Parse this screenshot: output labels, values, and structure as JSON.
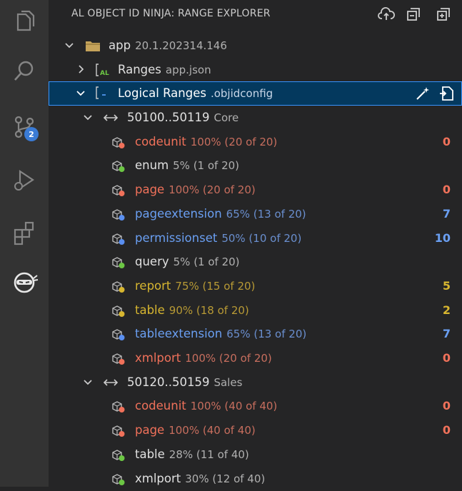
{
  "panel": {
    "title": "AL OBJECT ID NINJA: RANGE EXPLORER"
  },
  "activity": {
    "source_control_badge": "2"
  },
  "tree": {
    "app": {
      "label": "app",
      "desc": "20.1.202314.146"
    },
    "ranges": {
      "label": "Ranges",
      "desc": "app.json"
    },
    "logical": {
      "label": "Logical Ranges",
      "desc": ".objidconfig"
    },
    "groups": [
      {
        "range": "50100..50119",
        "name": "Core",
        "items": [
          {
            "name": "codeunit",
            "usage": "100% (20 of 20)",
            "count": "0",
            "status": "red"
          },
          {
            "name": "enum",
            "usage": "5% (1 of 20)",
            "count": "",
            "status": "green"
          },
          {
            "name": "page",
            "usage": "100% (20 of 20)",
            "count": "0",
            "status": "red"
          },
          {
            "name": "pageextension",
            "usage": "65% (13 of 20)",
            "count": "7",
            "status": "blue"
          },
          {
            "name": "permissionset",
            "usage": "50% (10 of 20)",
            "count": "10",
            "status": "blue"
          },
          {
            "name": "query",
            "usage": "5% (1 of 20)",
            "count": "",
            "status": "green"
          },
          {
            "name": "report",
            "usage": "75% (15 of 20)",
            "count": "5",
            "status": "yellow"
          },
          {
            "name": "table",
            "usage": "90% (18 of 20)",
            "count": "2",
            "status": "yellow"
          },
          {
            "name": "tableextension",
            "usage": "65% (13 of 20)",
            "count": "7",
            "status": "blue"
          },
          {
            "name": "xmlport",
            "usage": "100% (20 of 20)",
            "count": "0",
            "status": "red"
          }
        ]
      },
      {
        "range": "50120..50159",
        "name": "Sales",
        "items": [
          {
            "name": "codeunit",
            "usage": "100% (40 of 40)",
            "count": "0",
            "status": "red"
          },
          {
            "name": "page",
            "usage": "100% (40 of 40)",
            "count": "0",
            "status": "red"
          },
          {
            "name": "table",
            "usage": "28% (11 of 40)",
            "count": "",
            "status": "green"
          },
          {
            "name": "xmlport",
            "usage": "30% (12 of 40)",
            "count": "",
            "status": "green"
          }
        ]
      }
    ]
  },
  "colors": {
    "red": "#f0715a",
    "green": "#6cc644",
    "blue": "#5a8ff0",
    "yellow": "#d7b630"
  }
}
